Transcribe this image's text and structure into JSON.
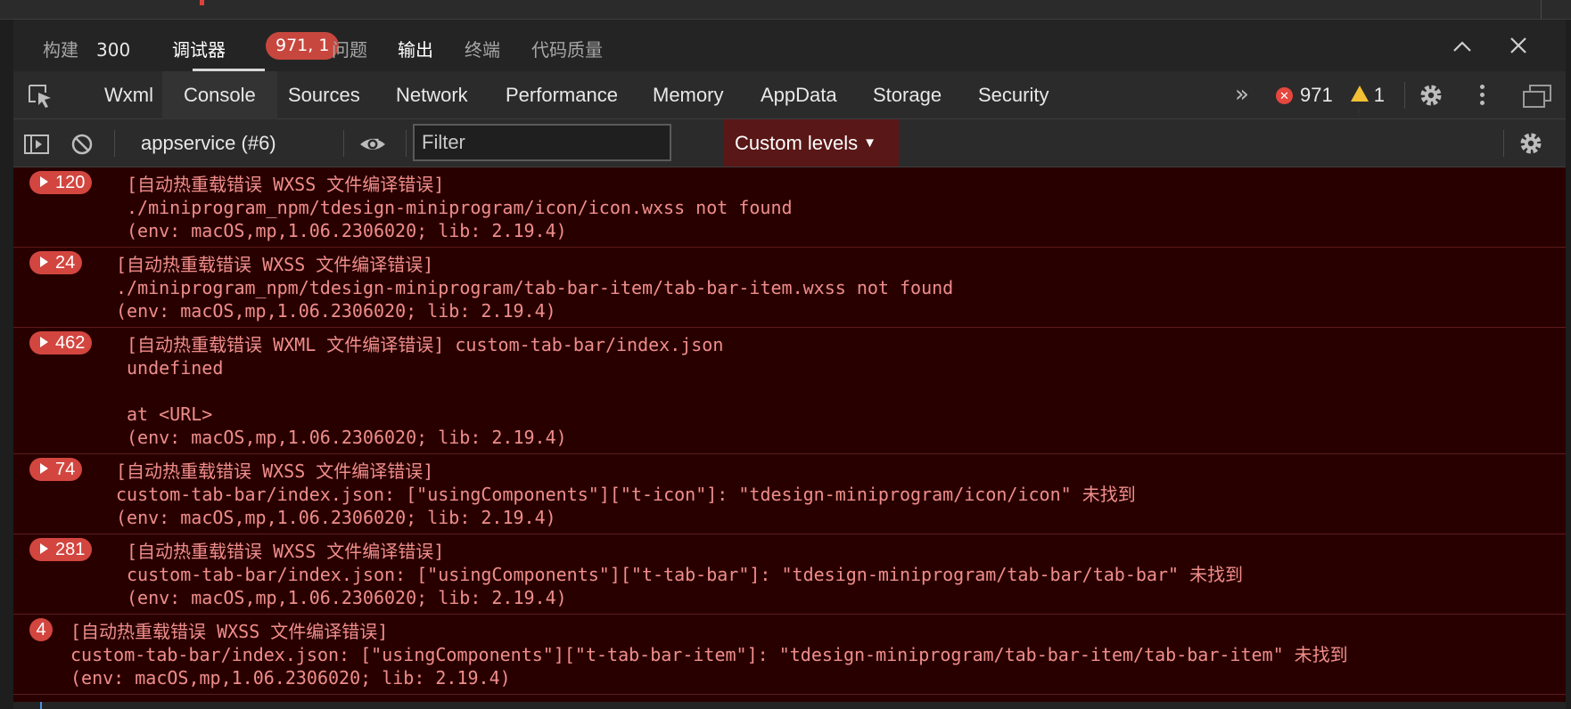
{
  "panel": {
    "tabs": [
      {
        "label": "构建",
        "count": "300"
      },
      {
        "label": "调试器",
        "badge": "971, 1"
      },
      {
        "label": "问题"
      },
      {
        "label": "输出"
      },
      {
        "label": "终端"
      },
      {
        "label": "代码质量"
      }
    ],
    "controls": {
      "collapse_icon": "chevron-up-icon",
      "close_icon": "close-icon"
    }
  },
  "devtools": {
    "tabs": [
      "Wxml",
      "Console",
      "Sources",
      "Network",
      "Performance",
      "Memory",
      "AppData",
      "Storage",
      "Security"
    ],
    "active_tab": "Console",
    "overflow_label": "»",
    "error_count": "971",
    "warning_count": "1"
  },
  "console": {
    "context": "appservice (#6)",
    "filter_placeholder": "Filter",
    "filter_value": "",
    "levels_label": "Custom levels"
  },
  "colors": {
    "error_bg": "#290000",
    "error_text": "#ef8e8b",
    "count_badge": "#d2463f",
    "levels_bg": "#5a1717"
  },
  "logs": [
    {
      "count": "120",
      "lines": [
        "[自动热重载错误 WXSS 文件编译错误]",
        "./miniprogram_npm/tdesign-miniprogram/icon/icon.wxss not found",
        "(env: macOS,mp,1.06.2306020; lib: 2.19.4)"
      ]
    },
    {
      "count": "24",
      "lines": [
        "[自动热重载错误 WXSS 文件编译错误]",
        "./miniprogram_npm/tdesign-miniprogram/tab-bar-item/tab-bar-item.wxss not found",
        "(env: macOS,mp,1.06.2306020; lib: 2.19.4)"
      ]
    },
    {
      "count": "462",
      "lines": [
        "[自动热重载错误 WXML 文件编译错误] custom-tab-bar/index.json",
        "undefined",
        "",
        "at <URL>",
        "(env: macOS,mp,1.06.2306020; lib: 2.19.4)"
      ]
    },
    {
      "count": "74",
      "lines": [
        "[自动热重载错误 WXSS 文件编译错误]",
        "custom-tab-bar/index.json: [\"usingComponents\"][\"t-icon\"]: \"tdesign-miniprogram/icon/icon\" 未找到",
        "(env: macOS,mp,1.06.2306020; lib: 2.19.4)"
      ]
    },
    {
      "count": "281",
      "lines": [
        "[自动热重载错误 WXSS 文件编译错误]",
        "custom-tab-bar/index.json: [\"usingComponents\"][\"t-tab-bar\"]: \"tdesign-miniprogram/tab-bar/tab-bar\" 未找到",
        "(env: macOS,mp,1.06.2306020; lib: 2.19.4)"
      ]
    },
    {
      "count": "4",
      "lines": [
        "[自动热重载错误 WXSS 文件编译错误]",
        "custom-tab-bar/index.json: [\"usingComponents\"][\"t-tab-bar-item\"]: \"tdesign-miniprogram/tab-bar-item/tab-bar-item\" 未找到",
        "(env: macOS,mp,1.06.2306020; lib: 2.19.4)"
      ]
    }
  ]
}
